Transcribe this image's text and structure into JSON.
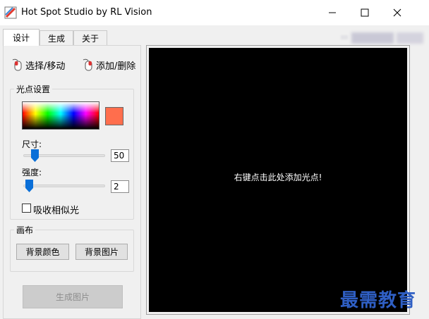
{
  "window": {
    "title": "Hot Spot Studio by RL Vision"
  },
  "tabs": [
    {
      "label": "设计"
    },
    {
      "label": "生成"
    },
    {
      "label": "关于"
    }
  ],
  "modes": {
    "select_label": "选择/移动",
    "add_label": "添加/删除"
  },
  "spot_settings": {
    "group_label": "光点设置",
    "swatch_color": "#ff6e4d",
    "size_label": "尺寸:",
    "size_value": "50",
    "intensity_label": "强度:",
    "intensity_value": "2",
    "similar_label": "吸收相似光"
  },
  "canvas_settings": {
    "group_label": "画布",
    "bg_color_button": "背景颜色",
    "bg_image_button": "背景图片"
  },
  "generate_button": "生成图片",
  "preview": {
    "hint": "右键点击此处添加光点!"
  },
  "watermark": "最需教育"
}
